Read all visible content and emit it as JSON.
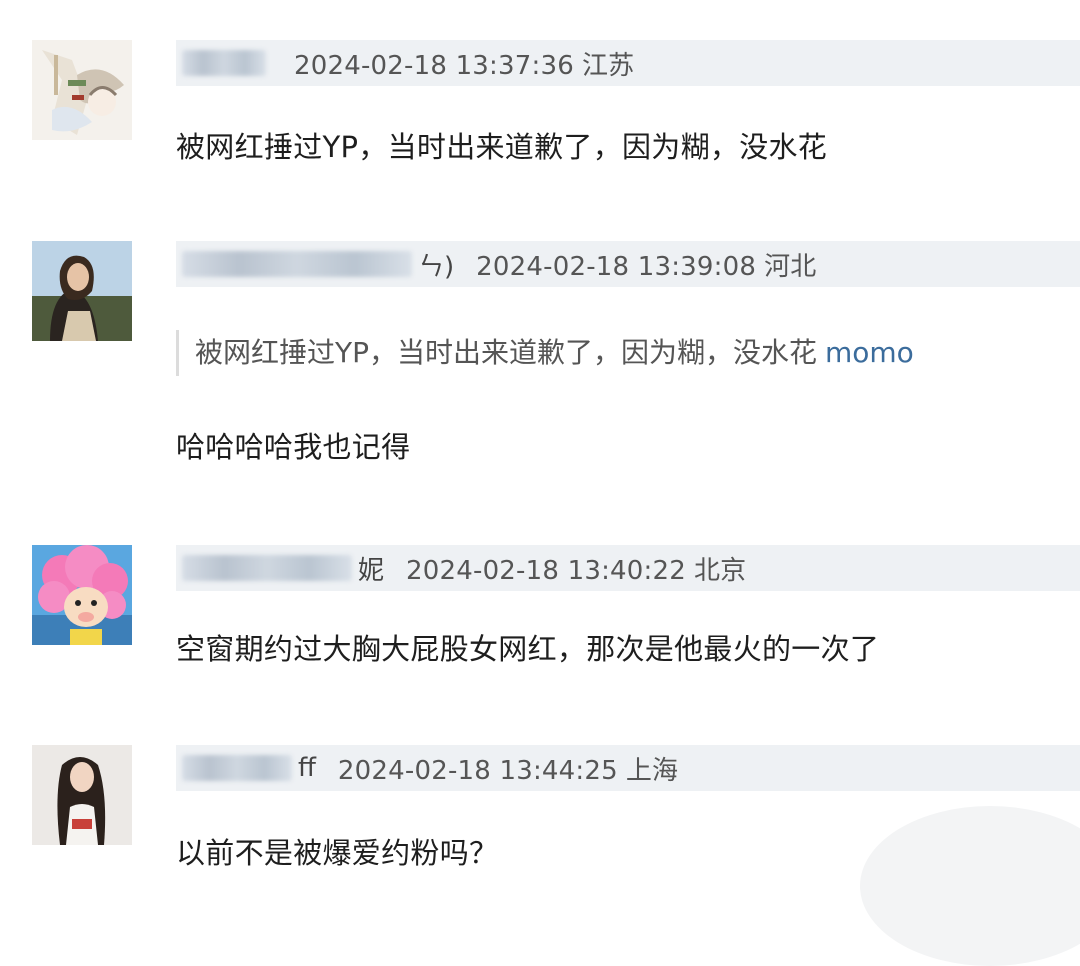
{
  "comments": [
    {
      "meta": {
        "datetime": "2024-02-18 13:37:36",
        "location": "江苏",
        "name_tail": ""
      },
      "avatar": "illustrated-character-avatar",
      "text": "被网红捶过YP，当时出来道歉了，因为糊，没水花"
    },
    {
      "meta": {
        "datetime": "2024-02-18 13:39:08",
        "location": "河北",
        "name_tail": "ㄣ)"
      },
      "avatar": "woman-photo-avatar",
      "quote": {
        "text": "被网红捶过YP，当时出来道歉了，因为糊，没水花",
        "mention": "momo"
      },
      "text": "哈哈哈哈我也记得"
    },
    {
      "meta": {
        "datetime": "2024-02-18 13:40:22",
        "location": "北京",
        "name_tail": "妮"
      },
      "avatar": "pink-hair-cartoon-avatar",
      "text": "空窗期约过大胸大屁股女网红，那次是他最火的一次了"
    },
    {
      "meta": {
        "datetime": "2024-02-18 13:44:25",
        "location": "上海",
        "name_tail": "ff"
      },
      "avatar": "long-hair-girl-avatar",
      "text": "以前不是被爆爱约粉吗？"
    }
  ],
  "colors": {
    "meta_bar": "#eef1f4",
    "mention": "#3b6c9c",
    "text": "#1e1e1e"
  }
}
